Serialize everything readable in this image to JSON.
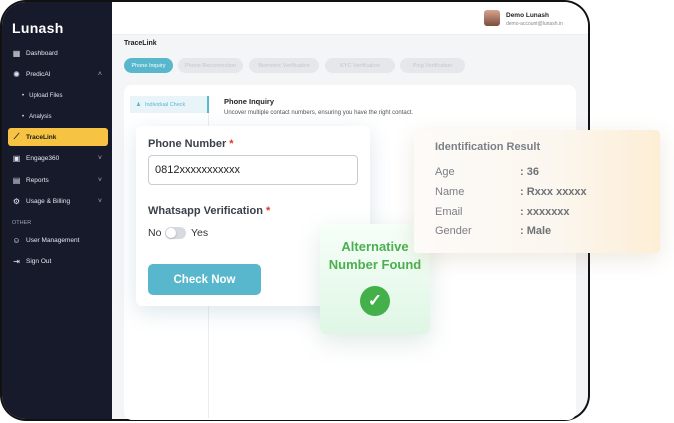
{
  "brand": "Lunash",
  "user": {
    "name": "Demo Lunash",
    "email": "demo-account@lunash.in"
  },
  "sidebar": {
    "items": [
      {
        "label": "Dashboard"
      },
      {
        "label": "PredicAI"
      },
      {
        "label": "TraceLink"
      },
      {
        "label": "Engage360"
      },
      {
        "label": "Reports"
      },
      {
        "label": "Usage & Billing"
      }
    ],
    "sub_items": [
      "Upload Files",
      "Analysis"
    ],
    "other_label": "OTHER",
    "other_items": [
      {
        "label": "User Management"
      },
      {
        "label": "Sign Out"
      }
    ]
  },
  "page": {
    "title": "TraceLink",
    "tabs": [
      {
        "label": "Phone Inquiry"
      },
      {
        "label": "Phone Reconnection"
      },
      {
        "label": "Biometric Verification"
      },
      {
        "label": "KYC Verification"
      },
      {
        "label": "Ping Verification"
      }
    ],
    "left_tab": "Individual Check",
    "section_title": "Phone Inquiry",
    "section_desc": "Uncover multiple contact numbers, ensuring you have the right contact."
  },
  "form": {
    "phone_label": "Phone Number",
    "phone_value": "0812xxxxxxxxxxx",
    "wa_label": "Whatsapp Verification",
    "required_mark": "*",
    "toggle_no": "No",
    "toggle_yes": "Yes",
    "submit_label": "Check Now"
  },
  "alt": {
    "text": "Alternative Number Found"
  },
  "result": {
    "title": "Identification Result",
    "rows": [
      {
        "k": "Age",
        "v": ": 36"
      },
      {
        "k": "Name",
        "v": ": Rxxx xxxxx"
      },
      {
        "k": "Email",
        "v": ": xxxxxxx"
      },
      {
        "k": "Gender",
        "v": ": Male"
      }
    ]
  },
  "colors": {
    "accent": "#58b7cc",
    "active_nav": "#f6c343",
    "success": "#43b04a",
    "sidebar": "#161a2b"
  }
}
